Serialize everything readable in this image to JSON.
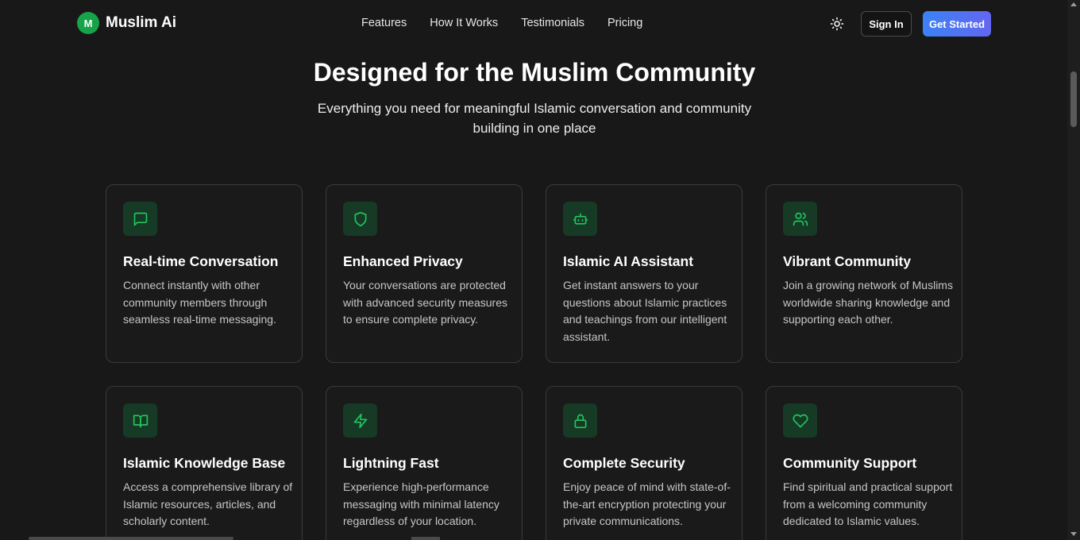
{
  "nav": {
    "logo_letter": "M",
    "brand": "Muslim Ai",
    "links": [
      "Features",
      "How It Works",
      "Testimonials",
      "Pricing"
    ],
    "theme_icon": "sun-icon",
    "sign_in": "Sign In",
    "get_started": "Get Started"
  },
  "hero": {
    "title": "Designed for the Muslim Community",
    "subtitle": "Everything you need for meaningful Islamic conversation and community building in one place"
  },
  "features": [
    {
      "icon": "message-square-icon",
      "title": "Real-time Conversation",
      "desc": "Connect instantly with other community members through seamless real-time messaging."
    },
    {
      "icon": "shield-icon",
      "title": "Enhanced Privacy",
      "desc": "Your conversations are protected with advanced security measures to ensure complete privacy."
    },
    {
      "icon": "bot-icon",
      "title": "Islamic AI Assistant",
      "desc": "Get instant answers to your questions about Islamic practices and teachings from our intelligent assistant."
    },
    {
      "icon": "users-icon",
      "title": "Vibrant Community",
      "desc": "Join a growing network of Muslims worldwide sharing knowledge and supporting each other."
    },
    {
      "icon": "book-open-icon",
      "title": "Islamic Knowledge Base",
      "desc": "Access a comprehensive library of Islamic resources, articles, and scholarly content."
    },
    {
      "icon": "zap-icon",
      "title": "Lightning Fast",
      "desc": "Experience high-performance messaging with minimal latency regardless of your location."
    },
    {
      "icon": "lock-icon",
      "title": "Complete Security",
      "desc": "Enjoy peace of mind with state-of-the-art encryption protecting your private communications."
    },
    {
      "icon": "heart-icon",
      "title": "Community Support",
      "desc": "Find spiritual and practical support from a welcoming community dedicated to Islamic values."
    }
  ],
  "colors": {
    "background": "#181818",
    "accent_green": "#22c55e",
    "icon_bg": "#163a26",
    "button_gradient_start": "#3b82f6",
    "button_gradient_end": "#6366f1"
  }
}
